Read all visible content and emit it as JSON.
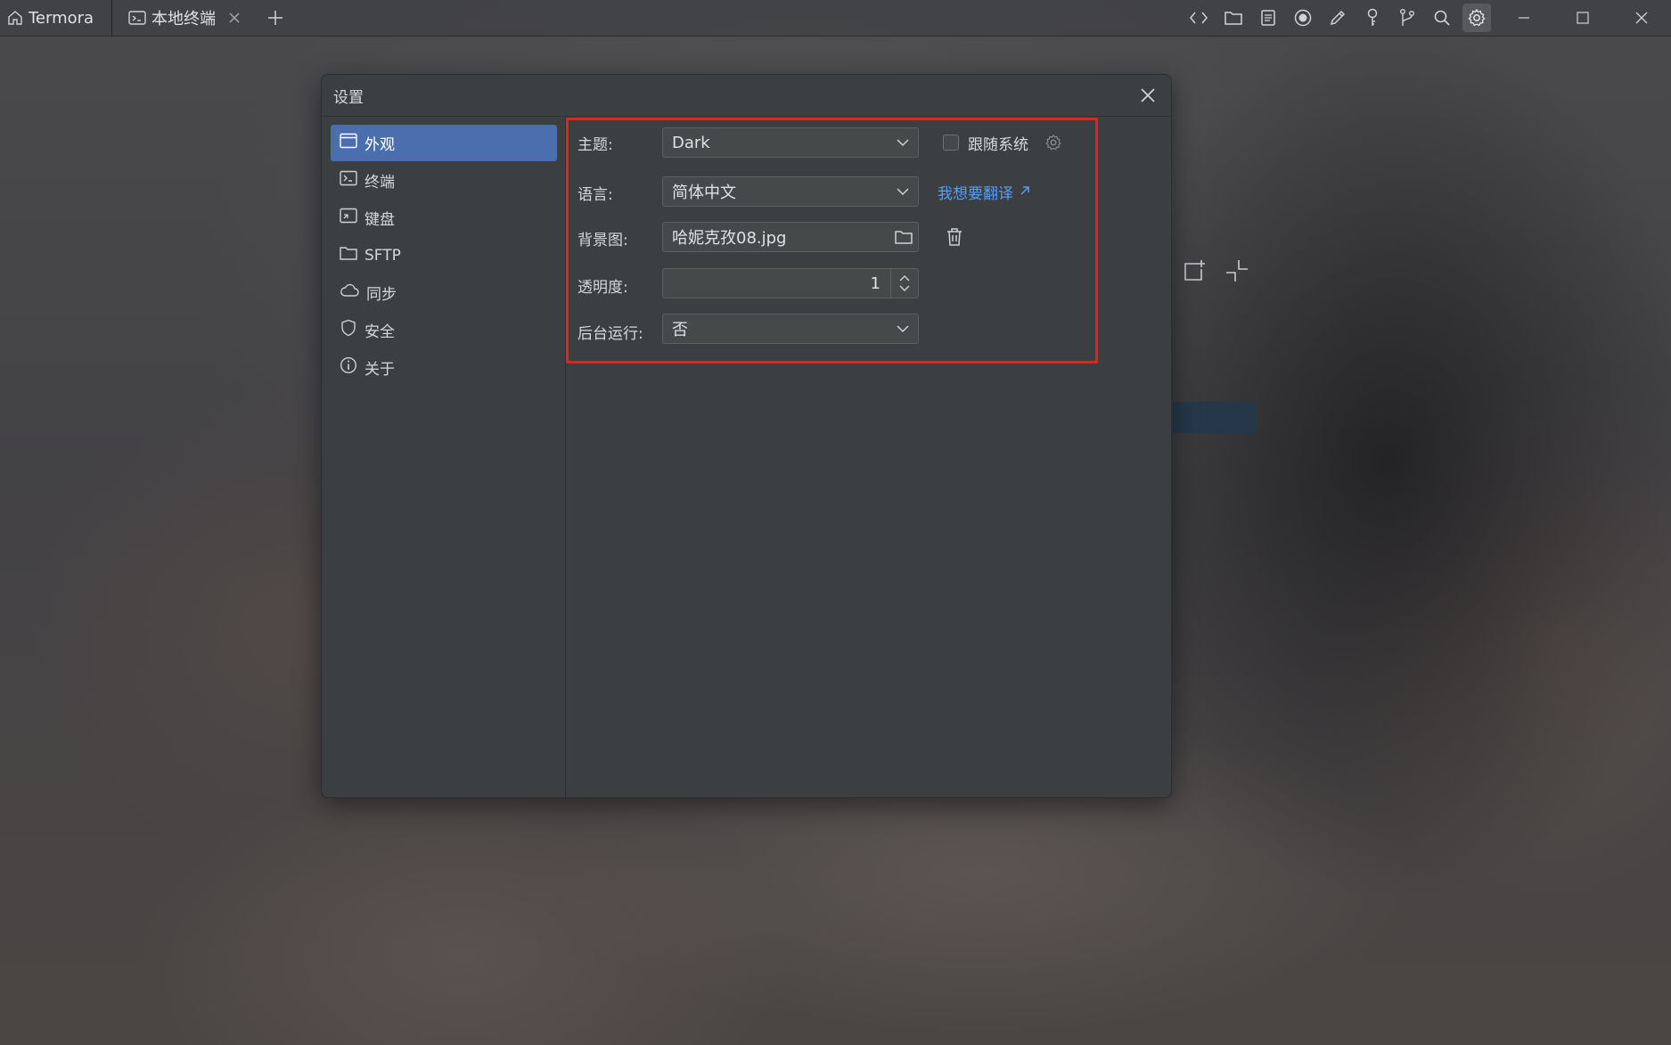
{
  "topbar": {
    "tabs": [
      {
        "label": "Termora",
        "icon": "home-icon"
      },
      {
        "label": "本地终端",
        "icon": "terminal-icon"
      }
    ],
    "tools": [
      "code-icon",
      "folder-icon",
      "notes-icon",
      "record-icon",
      "pen-icon",
      "key-icon",
      "branch-icon",
      "search-icon",
      "settings-icon"
    ],
    "window_controls": [
      "minimize-icon",
      "maximize-icon",
      "close-icon"
    ]
  },
  "dialog": {
    "title": "设置",
    "sidebar": [
      {
        "label": "外观",
        "icon": "window-icon",
        "selected": true
      },
      {
        "label": "终端",
        "icon": "terminal-icon"
      },
      {
        "label": "键盘",
        "icon": "keyboard-icon"
      },
      {
        "label": "SFTP",
        "icon": "folder-icon"
      },
      {
        "label": "同步",
        "icon": "cloud-icon"
      },
      {
        "label": "安全",
        "icon": "shield-icon"
      },
      {
        "label": "关于",
        "icon": "info-icon"
      }
    ],
    "appearance": {
      "theme": {
        "label": "主题:",
        "value": "Dark",
        "follow_system": {
          "label": "跟随系统",
          "checked": false
        }
      },
      "language": {
        "label": "语言:",
        "value": "简体中文",
        "translate_link": "我想要翻译"
      },
      "background": {
        "label": "背景图:",
        "value": "哈妮克孜08.jpg"
      },
      "opacity": {
        "label": "透明度:",
        "value": "1"
      },
      "background_run": {
        "label": "后台运行:",
        "value": "否"
      }
    }
  },
  "colors": {
    "accent": "#4b6eaf",
    "link": "#589df6",
    "highlight": "#e8221b"
  }
}
